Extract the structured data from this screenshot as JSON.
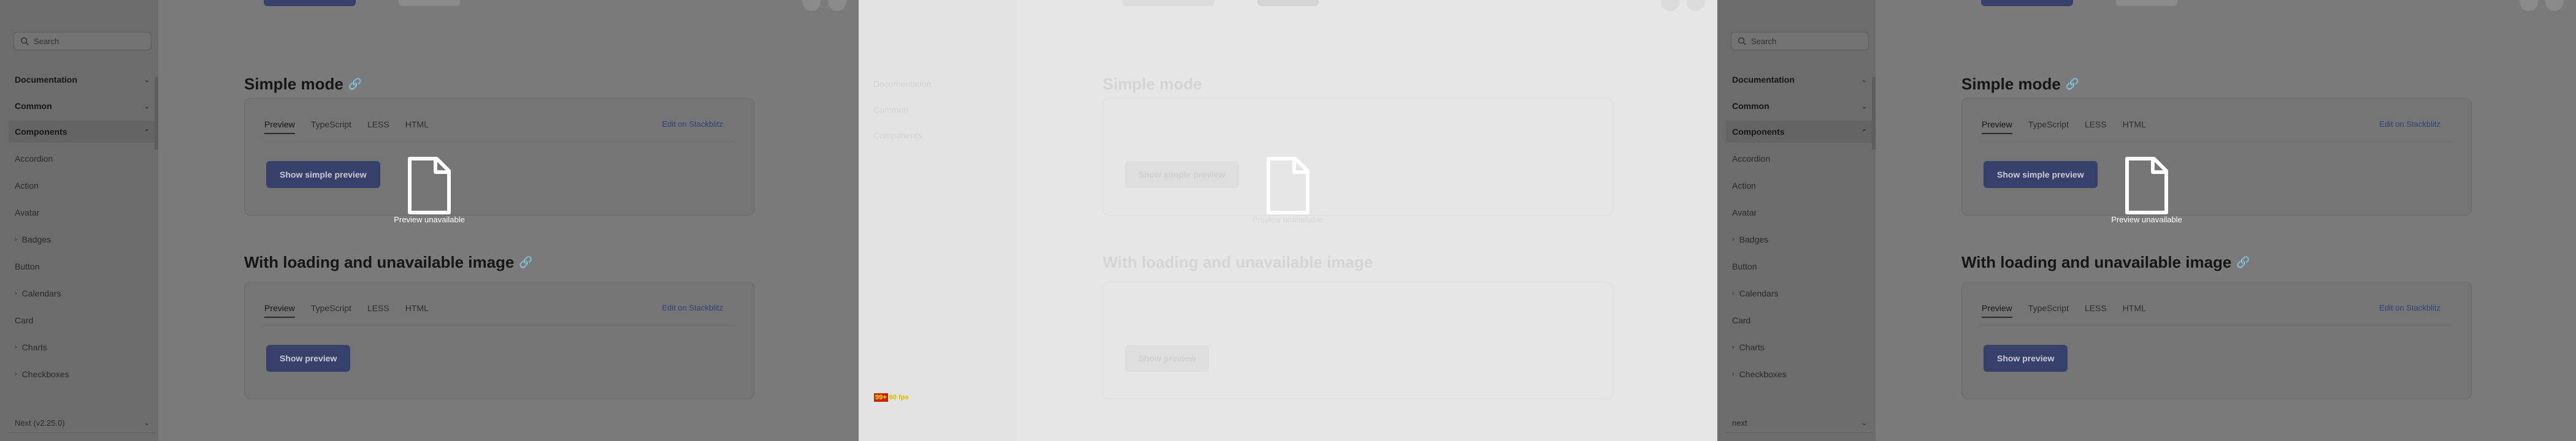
{
  "sidebar": {
    "search_placeholder": "Search",
    "sections": [
      {
        "label": "Documentation"
      },
      {
        "label": "Common"
      },
      {
        "label": "Components"
      }
    ],
    "items": [
      {
        "label": "Accordion",
        "expandable": false
      },
      {
        "label": "Action",
        "expandable": false
      },
      {
        "label": "Avatar",
        "expandable": false
      },
      {
        "label": "Badges",
        "expandable": true
      },
      {
        "label": "Button",
        "expandable": false
      },
      {
        "label": "Calendars",
        "expandable": true
      },
      {
        "label": "Card",
        "expandable": false
      },
      {
        "label": "Charts",
        "expandable": true
      },
      {
        "label": "Checkboxes",
        "expandable": true
      }
    ],
    "version_left": "Next (v2.25.0)",
    "version_right": "next"
  },
  "main": {
    "section1": {
      "title": "Simple mode",
      "tabs": [
        "Preview",
        "TypeScript",
        "LESS",
        "HTML"
      ],
      "stackblitz": "Edit on Stackblitz",
      "button": "Show simple preview"
    },
    "section2": {
      "title": "With loading and unavailable image",
      "tabs": [
        "Preview",
        "TypeScript",
        "LESS",
        "HTML"
      ],
      "stackblitz": "Edit on Stackblitz",
      "button": "Show preview"
    },
    "overlay_text": "Preview unavailable"
  },
  "perf_badge": {
    "a": "99+",
    "b": "60 fps"
  },
  "colors": {
    "primary": "#37406a",
    "scrim": "#7a7a7a",
    "washed": "#e6e6e6"
  }
}
